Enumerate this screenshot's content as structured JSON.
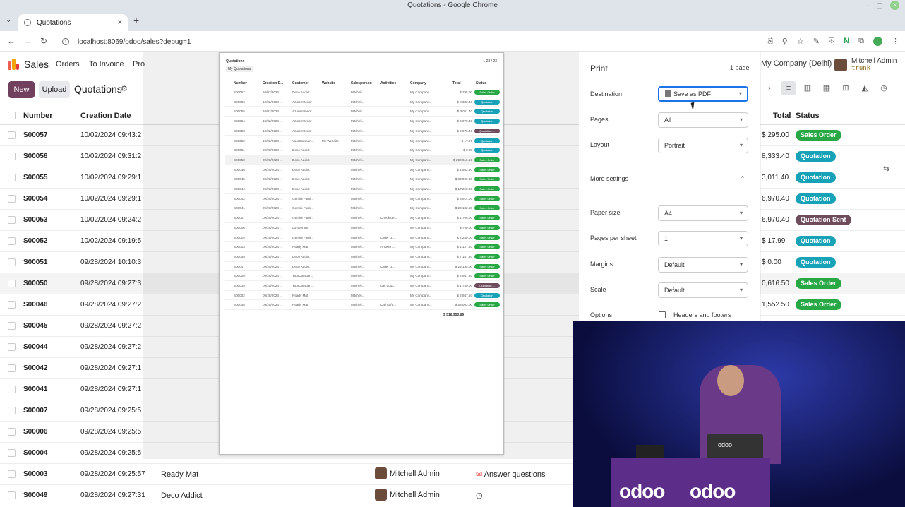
{
  "browser": {
    "window_title": "Quotations - Google Chrome",
    "tab_title": "Quotations",
    "url": "localhost:8069/odoo/sales?debug=1"
  },
  "app": {
    "name": "Sales",
    "menu": [
      "Orders",
      "To Invoice",
      "Pro"
    ],
    "new_label": "New",
    "upload_label": "Upload",
    "page_title": "Quotations",
    "company": "My Company (Delhi)",
    "user_name": "Mitchell Admin",
    "user_db": "trunk"
  },
  "columns": {
    "number": "Number",
    "creation_date": "Creation Date",
    "total": "Total",
    "status": "Status"
  },
  "rows": [
    {
      "number": "S00057",
      "date": "10/02/2024 09:43:2",
      "customer": "",
      "salesperson": "",
      "activity": "",
      "total": "$ 295.00",
      "status": "Sales Order",
      "kind": "order"
    },
    {
      "number": "S00056",
      "date": "10/02/2024 09:31:2",
      "customer": "",
      "salesperson": "",
      "activity": "",
      "total": "8,333.40",
      "status": "Quotation",
      "kind": "quot"
    },
    {
      "number": "S00055",
      "date": "10/02/2024 09:29:1",
      "customer": "",
      "salesperson": "",
      "activity": "",
      "total": "3,011.40",
      "status": "Quotation",
      "kind": "quot"
    },
    {
      "number": "S00054",
      "date": "10/02/2024 09:29:1",
      "customer": "",
      "salesperson": "",
      "activity": "",
      "total": "6,970.40",
      "status": "Quotation",
      "kind": "quot"
    },
    {
      "number": "S00053",
      "date": "10/02/2024 09:24:2",
      "customer": "",
      "salesperson": "",
      "activity": "",
      "total": "6,970.40",
      "status": "Quotation Sent",
      "kind": "sent"
    },
    {
      "number": "S00052",
      "date": "10/02/2024 09:19:5",
      "customer": "",
      "salesperson": "",
      "activity": "",
      "total": "$ 17.99",
      "status": "Quotation",
      "kind": "quot"
    },
    {
      "number": "S00051",
      "date": "09/28/2024 10:10:3",
      "customer": "",
      "salesperson": "",
      "activity": "",
      "total": "$ 0.00",
      "status": "Quotation",
      "kind": "quot"
    },
    {
      "number": "S00050",
      "date": "09/28/2024 09:27:3",
      "customer": "",
      "salesperson": "",
      "activity": "",
      "total": "0,616.50",
      "status": "Sales Order",
      "kind": "order"
    },
    {
      "number": "S00046",
      "date": "09/28/2024 09:27:2",
      "customer": "",
      "salesperson": "",
      "activity": "",
      "total": "1,552.50",
      "status": "Sales Order",
      "kind": "order"
    },
    {
      "number": "S00045",
      "date": "09/28/2024 09:27:2",
      "customer": "",
      "salesperson": "",
      "activity": "",
      "total": "",
      "status": "",
      "kind": ""
    },
    {
      "number": "S00044",
      "date": "09/28/2024 09:27:2",
      "customer": "",
      "salesperson": "",
      "activity": "",
      "total": "",
      "status": "",
      "kind": ""
    },
    {
      "number": "S00042",
      "date": "09/28/2024 09:27:1",
      "customer": "",
      "salesperson": "",
      "activity": "",
      "total": "",
      "status": "",
      "kind": ""
    },
    {
      "number": "S00041",
      "date": "09/28/2024 09:27:1",
      "customer": "",
      "salesperson": "",
      "activity": "",
      "total": "",
      "status": "",
      "kind": ""
    },
    {
      "number": "S00007",
      "date": "09/28/2024 09:25:5",
      "customer": "",
      "salesperson": "",
      "activity": "",
      "total": "",
      "status": "",
      "kind": ""
    },
    {
      "number": "S00006",
      "date": "09/28/2024 09:25:5",
      "customer": "",
      "salesperson": "",
      "activity": "",
      "total": "",
      "status": "",
      "kind": ""
    },
    {
      "number": "S00004",
      "date": "09/28/2024 09:25:5",
      "customer": "",
      "salesperson": "",
      "activity": "",
      "total": "",
      "status": "",
      "kind": ""
    },
    {
      "number": "S00003",
      "date": "09/28/2024 09:25:57",
      "customer": "Ready Mat",
      "salesperson": "Mitchell Admin",
      "activity": "Answer questions",
      "total": "",
      "status": "",
      "kind": ""
    },
    {
      "number": "S00049",
      "date": "09/28/2024 09:27:31",
      "customer": "Deco Addict",
      "salesperson": "Mitchell Admin",
      "activity": "",
      "total": "",
      "status": "",
      "kind": ""
    }
  ],
  "preview": {
    "title": "Quotations",
    "pages": "1-23 / 23",
    "filter": "My Quotations",
    "headers": [
      "Number",
      "Creation D...",
      "Customer",
      "Website",
      "Salesperson",
      "Activities",
      "Company",
      "Total",
      "Status"
    ],
    "rows": [
      [
        "S00057",
        "10/02/2024 ...",
        "Deco Addict",
        "",
        "Mitchell...",
        "",
        "My Company...",
        "$ 295.00",
        "Sales Order",
        "order"
      ],
      [
        "S00056",
        "10/02/2024 ...",
        "Azure Interior",
        "",
        "Mitchell...",
        "",
        "My Company...",
        "$ 8,333.40",
        "Quotation",
        "quot"
      ],
      [
        "S00055",
        "10/02/2024 ...",
        "Azure Interior",
        "",
        "Mitchell...",
        "",
        "My Company...",
        "$ 3,011.40",
        "Quotation",
        "quot"
      ],
      [
        "S00054",
        "10/02/2024 ...",
        "Azure Interior",
        "",
        "Mitchell...",
        "",
        "My Company...",
        "$ 6,970.40",
        "Quotation",
        "quot"
      ],
      [
        "S00053",
        "10/02/2024 ...",
        "Azure Interior",
        "",
        "Mitchell...",
        "",
        "My Company...",
        "$ 6,970.40",
        "Quotation ...",
        "sent"
      ],
      [
        "S00052",
        "10/02/2024 ...",
        "YourCompan...",
        "My Website",
        "Mitchell...",
        "",
        "My Company...",
        "$ 17.99",
        "Quotation",
        "quot"
      ],
      [
        "S00051",
        "09/28/2024 ...",
        "Deco Addict",
        "",
        "Mitchell...",
        "",
        "My Company...",
        "$ 0.00",
        "Quotation",
        "quot"
      ],
      [
        "S00050",
        "09/28/2024 ...",
        "Deco Addict",
        "",
        "Mitchell...",
        "",
        "My Company...",
        "$ 290,616.50",
        "Sales Order",
        "order"
      ],
      [
        "S00046",
        "09/28/2024 ...",
        "Deco Addict",
        "",
        "Mitchell...",
        "",
        "My Company...",
        "$ 1,552.50",
        "Sales Order",
        "order"
      ],
      [
        "S00045",
        "09/28/2024 ...",
        "Deco Addict",
        "",
        "Mitchell...",
        "",
        "My Company...",
        "$ 33,000.00",
        "Sales Order",
        "order"
      ],
      [
        "S00044",
        "09/28/2024 ...",
        "Deco Addict",
        "",
        "Mitchell...",
        "",
        "My Company...",
        "$ 17,250.00",
        "Sales Order",
        "order"
      ],
      [
        "S00042",
        "09/28/2024 ...",
        "Gemini Furni...",
        "",
        "Mitchell...",
        "",
        "My Company...",
        "$ 8,914.00",
        "Sales Order",
        "order"
      ],
      [
        "S00041",
        "09/28/2024 ...",
        "Gemini Furni...",
        "",
        "Mitchell...",
        "",
        "My Company...",
        "$ 20,182.50",
        "Sales Order",
        "order"
      ],
      [
        "S00007",
        "09/28/2024 ...",
        "Gemini Furni...",
        "",
        "Mitchell...",
        "Check de...",
        "My Company...",
        "$ 1,706.00",
        "Sales Order",
        "order"
      ],
      [
        "S00006",
        "09/28/2024 ...",
        "Lumber Inc",
        "",
        "Mitchell...",
        "",
        "My Company...",
        "$ 750.00",
        "Sales Order",
        "order"
      ],
      [
        "S00004",
        "09/28/2024 ...",
        "Gemini Furni...",
        "",
        "Mitchell...",
        "Order U...",
        "My Company...",
        "$ 2,240.00",
        "Sales Order",
        "order"
      ],
      [
        "S00003",
        "09/28/2024 ...",
        "Ready Mat",
        "",
        "Mitchell...",
        "Answer ...",
        "My Company...",
        "$ 1,127.50",
        "Sales Order",
        "order"
      ],
      [
        "S00049",
        "09/28/2024 ...",
        "Deco Addict",
        "",
        "Mitchell...",
        "",
        "My Company...",
        "$ 7,187.50",
        "Sales Order",
        "order"
      ],
      [
        "S00047",
        "09/28/2024 ...",
        "Deco Addict",
        "",
        "Mitchell...",
        "Order U...",
        "My Company...",
        "$ 25,185.00",
        "Sales Order",
        "order"
      ],
      [
        "S00020",
        "09/28/2024 ...",
        "YourCompan...",
        "",
        "Mitchell...",
        "",
        "My Company...",
        "$ 2,947.50",
        "Sales Order",
        "order"
      ],
      [
        "S00019",
        "09/28/2024 ...",
        "YourCompan...",
        "",
        "Mitchell...",
        "Get quot...",
        "My Company...",
        "$ 1,740.00",
        "Quotation ...",
        "sent"
      ],
      [
        "S00002",
        "09/28/2024 ...",
        "Ready Mat",
        "",
        "Mitchell...",
        "",
        "My Company...",
        "$ 2,947.50",
        "Quotation",
        "quot"
      ],
      [
        "S00048",
        "09/28/2024 ...",
        "Ready Mat",
        "",
        "Mitchell...",
        "Call to fo...",
        "My Company...",
        "$ 58,003.00",
        "Sales Order",
        "order"
      ]
    ],
    "sum": "$ 518,950.89"
  },
  "print": {
    "title": "Print",
    "page_count": "1 page",
    "destination_label": "Destination",
    "destination_value": "Save as PDF",
    "pages_label": "Pages",
    "pages_value": "All",
    "layout_label": "Layout",
    "layout_value": "Portrait",
    "more_settings_label": "More settings",
    "paper_size_label": "Paper size",
    "paper_size_value": "A4",
    "pages_per_sheet_label": "Pages per sheet",
    "pages_per_sheet_value": "1",
    "margins_label": "Margins",
    "margins_value": "Default",
    "scale_label": "Scale",
    "scale_value": "Default",
    "options_label": "Options",
    "headers_footers_label": "Headers and footers"
  },
  "video": {
    "logo_text": "odoo",
    "laptop_text": "odoo"
  },
  "colors": {
    "brand": "#71405f",
    "order": "#28a745",
    "quotation": "#17a2b8",
    "sent": "#6f4c5b"
  }
}
